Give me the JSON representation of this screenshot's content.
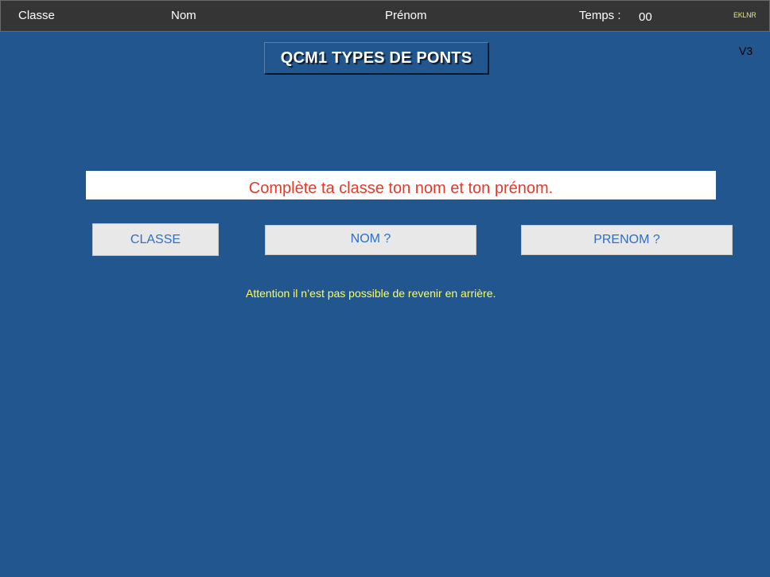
{
  "topbar": {
    "classe_label": "Classe",
    "nom_label": "Nom",
    "prenom_label": "Prénom",
    "temps_label": "Temps :",
    "temps_value": "00",
    "code": "EKLNR"
  },
  "title": "QCM1 TYPES DE PONTS",
  "version": "V3",
  "message": "Complète ta classe ton nom et ton prénom.",
  "buttons": {
    "classe": "CLASSE",
    "nom": "NOM ?",
    "prenom": "PRENOM ?"
  },
  "warning": "Attention il n’est pas possible de revenir en arrière.",
  "colors": {
    "background": "#21568f",
    "topbar": "#353535",
    "message_text": "#e53a2a",
    "button_text": "#2f6ec4",
    "warning_text": "#ffff55"
  }
}
